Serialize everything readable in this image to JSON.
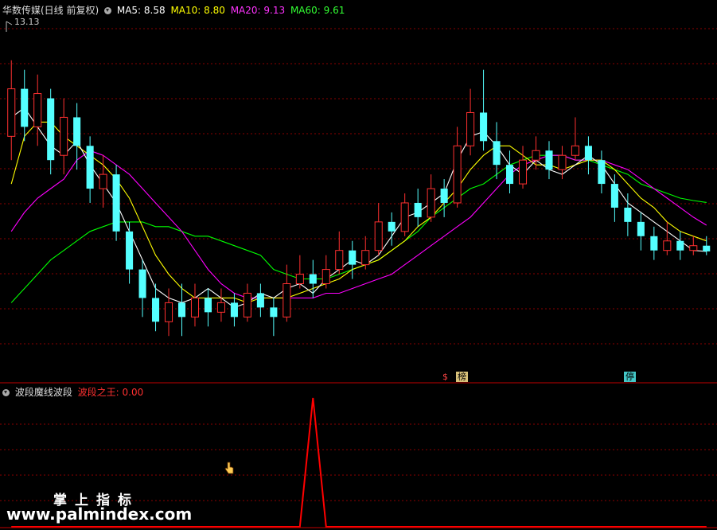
{
  "header": {
    "stock_title": "华数传媒(日线 前复权)",
    "ma5": "MA5: 8.58",
    "ma10": "MA10: 8.80",
    "ma20": "MA20: 9.13",
    "ma60": "MA60: 9.61",
    "high_label": "13.13"
  },
  "sub_header": {
    "indicator_name": "波段魔线波段",
    "series_label": "波段之王: 0.00"
  },
  "tags": {
    "tag1": "$",
    "tag2": "榜",
    "tag3": "停"
  },
  "watermark": {
    "line1": "掌上指标",
    "line2": "www.palmindex.com"
  },
  "colors": {
    "up": "#ff3030",
    "down": "#54ffff",
    "ma5": "#ffffff",
    "ma10": "#ffff00",
    "ma20": "#ff00ff",
    "ma60": "#00ff00",
    "indicator": "#ff0000",
    "grid": "#8b0000"
  },
  "chart_data": [
    {
      "type": "candlestick",
      "title": "华数传媒(日线 前复权)",
      "ylim": [
        6.0,
        13.5
      ],
      "series": [
        {
          "name": "MA5",
          "values": [
            11.4,
            11.6,
            11.2,
            10.8,
            10.6,
            10.9,
            10.4,
            10.0,
            9.6,
            9.0,
            8.4,
            7.8,
            7.6,
            7.5,
            7.6,
            7.8,
            7.6,
            7.4,
            7.5,
            7.7,
            7.6,
            7.8,
            7.9,
            7.7,
            8.0,
            8.2,
            8.4,
            8.3,
            8.5,
            8.9,
            9.3,
            9.4,
            9.6,
            9.8,
            10.5,
            11.0,
            11.1,
            10.8,
            10.4,
            10.2,
            10.5,
            10.3,
            10.2,
            10.4,
            10.6,
            10.4,
            10.0,
            9.6,
            9.4,
            9.2,
            9.0,
            8.8,
            8.6,
            8.58
          ]
        },
        {
          "name": "MA10",
          "values": [
            10.0,
            11.0,
            11.3,
            11.3,
            11.0,
            10.8,
            10.6,
            10.4,
            10.1,
            9.7,
            9.1,
            8.5,
            8.1,
            7.8,
            7.6,
            7.6,
            7.6,
            7.6,
            7.5,
            7.6,
            7.6,
            7.6,
            7.7,
            7.8,
            7.9,
            8.0,
            8.2,
            8.3,
            8.4,
            8.6,
            8.8,
            9.1,
            9.3,
            9.6,
            9.9,
            10.3,
            10.6,
            10.8,
            10.8,
            10.6,
            10.4,
            10.4,
            10.3,
            10.4,
            10.5,
            10.5,
            10.3,
            10.0,
            9.7,
            9.5,
            9.2,
            9.0,
            8.9,
            8.8
          ]
        },
        {
          "name": "MA20",
          "values": [
            9.0,
            9.4,
            9.7,
            9.9,
            10.1,
            10.5,
            10.7,
            10.6,
            10.4,
            10.2,
            9.9,
            9.6,
            9.3,
            9.0,
            8.6,
            8.2,
            7.9,
            7.7,
            7.6,
            7.6,
            7.6,
            7.6,
            7.6,
            7.6,
            7.7,
            7.7,
            7.8,
            7.9,
            8.0,
            8.1,
            8.3,
            8.5,
            8.7,
            8.9,
            9.1,
            9.3,
            9.6,
            9.9,
            10.2,
            10.4,
            10.5,
            10.6,
            10.6,
            10.5,
            10.5,
            10.5,
            10.4,
            10.3,
            10.1,
            9.9,
            9.7,
            9.5,
            9.3,
            9.13
          ]
        },
        {
          "name": "MA60",
          "values": [
            7.5,
            7.8,
            8.1,
            8.4,
            8.6,
            8.8,
            9.0,
            9.1,
            9.2,
            9.2,
            9.2,
            9.1,
            9.1,
            9.0,
            8.9,
            8.9,
            8.8,
            8.7,
            8.6,
            8.5,
            8.2,
            8.1,
            8.0,
            8.0,
            8.0,
            8.1,
            8.2,
            8.3,
            8.4,
            8.6,
            8.8,
            9.0,
            9.3,
            9.5,
            9.7,
            9.9,
            10.0,
            10.2,
            10.4,
            10.5,
            10.6,
            10.6,
            10.6,
            10.5,
            10.5,
            10.4,
            10.3,
            10.2,
            10.0,
            9.9,
            9.8,
            9.7,
            9.65,
            9.61
          ]
        }
      ],
      "candles": [
        [
          11.0,
          12.0,
          12.6,
          10.5
        ],
        [
          12.0,
          11.2,
          12.4,
          10.9
        ],
        [
          11.2,
          11.9,
          12.3,
          10.8
        ],
        [
          11.8,
          10.5,
          12.0,
          10.2
        ],
        [
          10.6,
          11.4,
          11.8,
          10.2
        ],
        [
          11.4,
          10.8,
          11.7,
          10.3
        ],
        [
          10.8,
          9.9,
          11.0,
          9.6
        ],
        [
          9.9,
          10.2,
          10.6,
          9.5
        ],
        [
          10.2,
          9.0,
          10.4,
          8.8
        ],
        [
          9.0,
          8.2,
          9.2,
          7.9
        ],
        [
          8.2,
          7.6,
          8.4,
          7.2
        ],
        [
          7.6,
          7.1,
          7.9,
          6.9
        ],
        [
          7.1,
          7.5,
          7.8,
          6.8
        ],
        [
          7.5,
          7.2,
          7.9,
          6.8
        ],
        [
          7.2,
          7.6,
          7.9,
          7.0
        ],
        [
          7.6,
          7.3,
          7.8,
          7.0
        ],
        [
          7.3,
          7.5,
          7.8,
          7.1
        ],
        [
          7.5,
          7.2,
          7.7,
          7.0
        ],
        [
          7.2,
          7.7,
          7.9,
          7.1
        ],
        [
          7.7,
          7.4,
          7.9,
          7.2
        ],
        [
          7.4,
          7.2,
          7.6,
          6.8
        ],
        [
          7.2,
          7.9,
          8.3,
          7.1
        ],
        [
          7.9,
          8.1,
          8.5,
          7.8
        ],
        [
          8.1,
          7.9,
          8.4,
          7.6
        ],
        [
          7.9,
          8.2,
          8.5,
          7.8
        ],
        [
          8.2,
          8.6,
          9.0,
          8.1
        ],
        [
          8.6,
          8.3,
          8.8,
          8.0
        ],
        [
          8.3,
          8.6,
          8.9,
          8.2
        ],
        [
          8.6,
          9.2,
          9.6,
          8.5
        ],
        [
          9.2,
          9.0,
          9.4,
          8.7
        ],
        [
          9.0,
          9.6,
          9.8,
          8.9
        ],
        [
          9.6,
          9.3,
          9.9,
          9.1
        ],
        [
          9.3,
          9.9,
          10.2,
          9.2
        ],
        [
          9.9,
          9.6,
          10.1,
          9.3
        ],
        [
          9.6,
          10.8,
          11.2,
          9.5
        ],
        [
          10.8,
          11.5,
          12.0,
          10.6
        ],
        [
          11.5,
          10.9,
          12.4,
          10.7
        ],
        [
          10.9,
          10.4,
          11.3,
          10.1
        ],
        [
          10.4,
          10.0,
          10.7,
          9.8
        ],
        [
          10.0,
          10.5,
          10.8,
          9.9
        ],
        [
          10.5,
          10.7,
          11.0,
          10.3
        ],
        [
          10.7,
          10.3,
          10.9,
          10.1
        ],
        [
          10.3,
          10.6,
          10.8,
          10.1
        ],
        [
          10.6,
          10.8,
          11.4,
          10.5
        ],
        [
          10.8,
          10.5,
          11.0,
          10.2
        ],
        [
          10.5,
          10.0,
          10.7,
          9.8
        ],
        [
          10.0,
          9.5,
          10.2,
          9.2
        ],
        [
          9.5,
          9.2,
          9.8,
          8.9
        ],
        [
          9.2,
          8.9,
          9.4,
          8.6
        ],
        [
          8.9,
          8.6,
          9.1,
          8.4
        ],
        [
          8.6,
          8.8,
          9.2,
          8.5
        ],
        [
          8.8,
          8.6,
          9.0,
          8.4
        ],
        [
          8.6,
          8.7,
          8.9,
          8.5
        ],
        [
          8.7,
          8.58,
          8.9,
          8.5
        ]
      ]
    },
    {
      "type": "line",
      "title": "波段魔线波段",
      "series": [
        {
          "name": "波段之王",
          "values": [
            0,
            0,
            0,
            0,
            0,
            0,
            0,
            0,
            0,
            0,
            0,
            0,
            0,
            0,
            0,
            0,
            0,
            0,
            0,
            0,
            0,
            0,
            0,
            1,
            0,
            0,
            0,
            0,
            0,
            0,
            0,
            0,
            0,
            0,
            0,
            0,
            0,
            0,
            0,
            0,
            0,
            0,
            0,
            0,
            0,
            0,
            0,
            0,
            0,
            0,
            0,
            0,
            0,
            0
          ]
        }
      ],
      "current_value": "0.00",
      "ylim": [
        0,
        1
      ]
    }
  ]
}
